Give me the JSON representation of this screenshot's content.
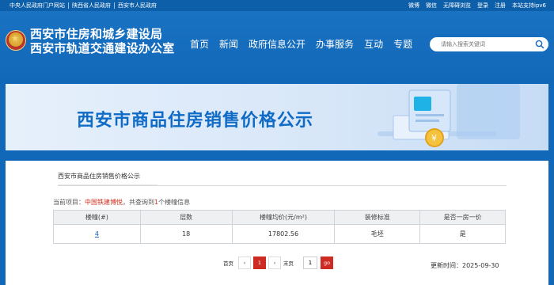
{
  "topbar": {
    "left_links": [
      "中央人民政府门户网站",
      "陕西省人民政府",
      "西安市人民政府"
    ],
    "right_links": [
      "微博",
      "微信",
      "无障碍浏览",
      "登录",
      "注册",
      "本站支持ipv6"
    ]
  },
  "header": {
    "title_line1": "西安市住房和城乡建设局",
    "title_line2": "西安市轨道交通建设办公室",
    "nav": [
      "首页",
      "新闻",
      "政府信息公开",
      "办事服务",
      "互动",
      "专题"
    ],
    "search_placeholder": "请输入搜索关键词"
  },
  "banner": {
    "title": "西安市商品住房销售价格公示"
  },
  "content": {
    "tab_title": "西安市商品住房销售价格公示",
    "info_prefix": "当前项目：",
    "project_name": "中国铁建博悦",
    "info_middle": "，共查询到",
    "result_count": "1",
    "info_suffix": "个楼幢信息",
    "table": {
      "headers": [
        "楼幢(#)",
        "层数",
        "楼幢均价(元/m²)",
        "装修标准",
        "是否一房一价"
      ],
      "rows": [
        [
          "4",
          "18",
          "17802.56",
          "毛坯",
          "是"
        ]
      ]
    },
    "pager": {
      "first": "首页",
      "prev": "‹",
      "current": "1",
      "next": "›",
      "last": "末页",
      "page_input": "1",
      "go": "go"
    },
    "update_time": "更新时间：2025-09-30"
  },
  "colors": {
    "primary_blue": "#1168b8",
    "accent_red": "#cf2b25",
    "link_blue": "#1a5fb0"
  }
}
